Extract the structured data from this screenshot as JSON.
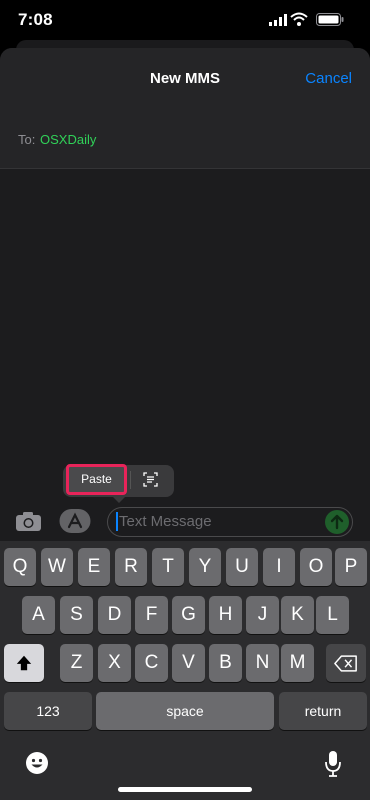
{
  "status": {
    "time": "7:08"
  },
  "header": {
    "title": "New MMS",
    "cancel_label": "Cancel"
  },
  "recipient": {
    "label": "To:",
    "value": "OSXDaily"
  },
  "edit_menu": {
    "paste_label": "Paste",
    "scan_icon": "scan-text-icon",
    "highlight_color": "#e8245a"
  },
  "composer": {
    "placeholder": "Text Message",
    "camera_icon": "camera-icon",
    "apps_icon": "app-store-icon",
    "send_icon": "send-arrow-icon"
  },
  "keyboard": {
    "row1": [
      "Q",
      "W",
      "E",
      "R",
      "T",
      "Y",
      "U",
      "I",
      "O",
      "P"
    ],
    "row2": [
      "A",
      "S",
      "D",
      "F",
      "G",
      "H",
      "J",
      "K",
      "L"
    ],
    "row3": [
      "Z",
      "X",
      "C",
      "V",
      "B",
      "N",
      "M"
    ],
    "numbers_label": "123",
    "space_label": "space",
    "return_label": "return"
  },
  "colors": {
    "accent": "#0a84ff",
    "recipient": "#30d158"
  }
}
